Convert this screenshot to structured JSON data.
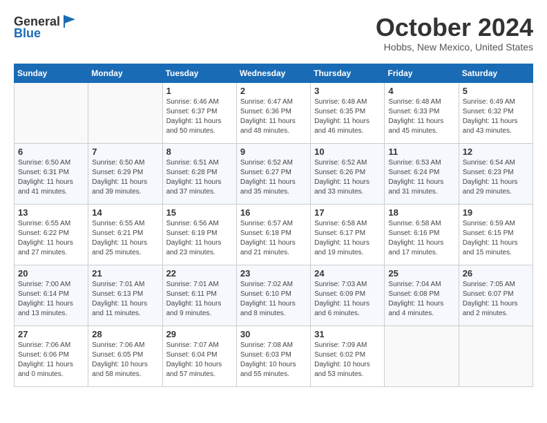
{
  "header": {
    "logo_line1": "General",
    "logo_line2": "Blue",
    "month_title": "October 2024",
    "location": "Hobbs, New Mexico, United States"
  },
  "days_of_week": [
    "Sunday",
    "Monday",
    "Tuesday",
    "Wednesday",
    "Thursday",
    "Friday",
    "Saturday"
  ],
  "weeks": [
    [
      {
        "day": "",
        "empty": true
      },
      {
        "day": "",
        "empty": true
      },
      {
        "day": "1",
        "sunrise": "Sunrise: 6:46 AM",
        "sunset": "Sunset: 6:37 PM",
        "daylight": "Daylight: 11 hours and 50 minutes."
      },
      {
        "day": "2",
        "sunrise": "Sunrise: 6:47 AM",
        "sunset": "Sunset: 6:36 PM",
        "daylight": "Daylight: 11 hours and 48 minutes."
      },
      {
        "day": "3",
        "sunrise": "Sunrise: 6:48 AM",
        "sunset": "Sunset: 6:35 PM",
        "daylight": "Daylight: 11 hours and 46 minutes."
      },
      {
        "day": "4",
        "sunrise": "Sunrise: 6:48 AM",
        "sunset": "Sunset: 6:33 PM",
        "daylight": "Daylight: 11 hours and 45 minutes."
      },
      {
        "day": "5",
        "sunrise": "Sunrise: 6:49 AM",
        "sunset": "Sunset: 6:32 PM",
        "daylight": "Daylight: 11 hours and 43 minutes."
      }
    ],
    [
      {
        "day": "6",
        "sunrise": "Sunrise: 6:50 AM",
        "sunset": "Sunset: 6:31 PM",
        "daylight": "Daylight: 11 hours and 41 minutes."
      },
      {
        "day": "7",
        "sunrise": "Sunrise: 6:50 AM",
        "sunset": "Sunset: 6:29 PM",
        "daylight": "Daylight: 11 hours and 39 minutes."
      },
      {
        "day": "8",
        "sunrise": "Sunrise: 6:51 AM",
        "sunset": "Sunset: 6:28 PM",
        "daylight": "Daylight: 11 hours and 37 minutes."
      },
      {
        "day": "9",
        "sunrise": "Sunrise: 6:52 AM",
        "sunset": "Sunset: 6:27 PM",
        "daylight": "Daylight: 11 hours and 35 minutes."
      },
      {
        "day": "10",
        "sunrise": "Sunrise: 6:52 AM",
        "sunset": "Sunset: 6:26 PM",
        "daylight": "Daylight: 11 hours and 33 minutes."
      },
      {
        "day": "11",
        "sunrise": "Sunrise: 6:53 AM",
        "sunset": "Sunset: 6:24 PM",
        "daylight": "Daylight: 11 hours and 31 minutes."
      },
      {
        "day": "12",
        "sunrise": "Sunrise: 6:54 AM",
        "sunset": "Sunset: 6:23 PM",
        "daylight": "Daylight: 11 hours and 29 minutes."
      }
    ],
    [
      {
        "day": "13",
        "sunrise": "Sunrise: 6:55 AM",
        "sunset": "Sunset: 6:22 PM",
        "daylight": "Daylight: 11 hours and 27 minutes."
      },
      {
        "day": "14",
        "sunrise": "Sunrise: 6:55 AM",
        "sunset": "Sunset: 6:21 PM",
        "daylight": "Daylight: 11 hours and 25 minutes."
      },
      {
        "day": "15",
        "sunrise": "Sunrise: 6:56 AM",
        "sunset": "Sunset: 6:19 PM",
        "daylight": "Daylight: 11 hours and 23 minutes."
      },
      {
        "day": "16",
        "sunrise": "Sunrise: 6:57 AM",
        "sunset": "Sunset: 6:18 PM",
        "daylight": "Daylight: 11 hours and 21 minutes."
      },
      {
        "day": "17",
        "sunrise": "Sunrise: 6:58 AM",
        "sunset": "Sunset: 6:17 PM",
        "daylight": "Daylight: 11 hours and 19 minutes."
      },
      {
        "day": "18",
        "sunrise": "Sunrise: 6:58 AM",
        "sunset": "Sunset: 6:16 PM",
        "daylight": "Daylight: 11 hours and 17 minutes."
      },
      {
        "day": "19",
        "sunrise": "Sunrise: 6:59 AM",
        "sunset": "Sunset: 6:15 PM",
        "daylight": "Daylight: 11 hours and 15 minutes."
      }
    ],
    [
      {
        "day": "20",
        "sunrise": "Sunrise: 7:00 AM",
        "sunset": "Sunset: 6:14 PM",
        "daylight": "Daylight: 11 hours and 13 minutes."
      },
      {
        "day": "21",
        "sunrise": "Sunrise: 7:01 AM",
        "sunset": "Sunset: 6:13 PM",
        "daylight": "Daylight: 11 hours and 11 minutes."
      },
      {
        "day": "22",
        "sunrise": "Sunrise: 7:01 AM",
        "sunset": "Sunset: 6:11 PM",
        "daylight": "Daylight: 11 hours and 9 minutes."
      },
      {
        "day": "23",
        "sunrise": "Sunrise: 7:02 AM",
        "sunset": "Sunset: 6:10 PM",
        "daylight": "Daylight: 11 hours and 8 minutes."
      },
      {
        "day": "24",
        "sunrise": "Sunrise: 7:03 AM",
        "sunset": "Sunset: 6:09 PM",
        "daylight": "Daylight: 11 hours and 6 minutes."
      },
      {
        "day": "25",
        "sunrise": "Sunrise: 7:04 AM",
        "sunset": "Sunset: 6:08 PM",
        "daylight": "Daylight: 11 hours and 4 minutes."
      },
      {
        "day": "26",
        "sunrise": "Sunrise: 7:05 AM",
        "sunset": "Sunset: 6:07 PM",
        "daylight": "Daylight: 11 hours and 2 minutes."
      }
    ],
    [
      {
        "day": "27",
        "sunrise": "Sunrise: 7:06 AM",
        "sunset": "Sunset: 6:06 PM",
        "daylight": "Daylight: 11 hours and 0 minutes."
      },
      {
        "day": "28",
        "sunrise": "Sunrise: 7:06 AM",
        "sunset": "Sunset: 6:05 PM",
        "daylight": "Daylight: 10 hours and 58 minutes."
      },
      {
        "day": "29",
        "sunrise": "Sunrise: 7:07 AM",
        "sunset": "Sunset: 6:04 PM",
        "daylight": "Daylight: 10 hours and 57 minutes."
      },
      {
        "day": "30",
        "sunrise": "Sunrise: 7:08 AM",
        "sunset": "Sunset: 6:03 PM",
        "daylight": "Daylight: 10 hours and 55 minutes."
      },
      {
        "day": "31",
        "sunrise": "Sunrise: 7:09 AM",
        "sunset": "Sunset: 6:02 PM",
        "daylight": "Daylight: 10 hours and 53 minutes."
      },
      {
        "day": "",
        "empty": true
      },
      {
        "day": "",
        "empty": true
      }
    ]
  ]
}
